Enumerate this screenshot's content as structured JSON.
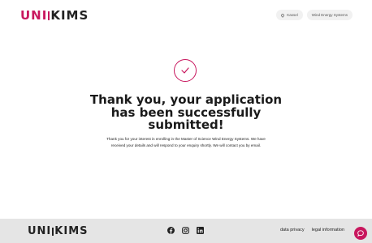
{
  "header": {
    "logo_left": "UNI",
    "logo_right": "KIMS",
    "chips": [
      {
        "label": "Kassel",
        "icon": "location-pin-icon"
      },
      {
        "label": "Wind Energy Systems"
      }
    ]
  },
  "main": {
    "icon": "check-icon",
    "title": "Thank you, your application has been successfully submitted!",
    "description": "Thank you for your interest in enrolling in the Master of Science Wind Energy Systems. We have received your details and will respond to your enquiry shortly. We will contact you by email."
  },
  "footer": {
    "logo_left": "UNI",
    "logo_right": "KIMS",
    "social": [
      "facebook-icon",
      "instagram-icon",
      "linkedin-icon"
    ],
    "links": [
      "data privacy",
      "legal information"
    ]
  },
  "chat": {
    "icon": "chat-icon"
  },
  "colors": {
    "accent": "#c8175e",
    "footer_bg": "#e5e5e5",
    "text": "#1a1a1a"
  }
}
